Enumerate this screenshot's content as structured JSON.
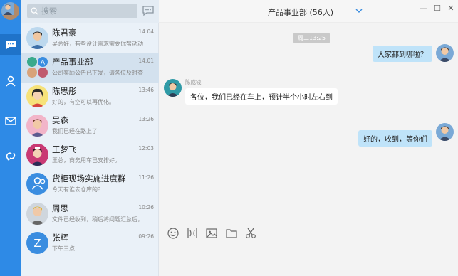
{
  "search": {
    "placeholder": "搜索"
  },
  "conversations": [
    {
      "name": "陈君豪",
      "time": "14:04",
      "preview": "吴总好，有些设计需求需要你帮动动"
    },
    {
      "name": "产品事业部",
      "time": "14:01",
      "preview": "公司奖励公告已下发，请各位及时查",
      "group_letter": "A"
    },
    {
      "name": "陈思彤",
      "time": "13:46",
      "preview": "好的，有空可以再优化。"
    },
    {
      "name": "吴森",
      "time": "13:26",
      "preview": "我们已经在路上了"
    },
    {
      "name": "王梦飞",
      "time": "12:03",
      "preview": "王总，商务用车已安排好。"
    },
    {
      "name": "货柜现场实施进度群",
      "time": "11:26",
      "preview": "今天有谁去仓库的？"
    },
    {
      "name": "周思",
      "time": "10:26",
      "preview": "文件已经收到，稍后将问题汇总后，"
    },
    {
      "name": "张辉",
      "time": "09:26",
      "preview": "下午三点",
      "letter": "Z"
    }
  ],
  "chat": {
    "title": "产品事业部 (56人)",
    "timestamp": "周二13:25",
    "messages": [
      {
        "direction": "out",
        "text": "大家都到哪啦？"
      },
      {
        "direction": "in",
        "sender": "陈成钱",
        "text": "各位，我们已经在车上，预计半个小时左右到"
      },
      {
        "direction": "out",
        "text": "好的，收到，等你们"
      }
    ]
  },
  "window": {
    "minimize": "—",
    "maximize": "☐",
    "close": "✕"
  },
  "colors": {
    "rail": "#2e8ae6",
    "out_bubble": "#bfe3f9",
    "selected_row": "#d3e1ee"
  },
  "icons": {
    "rail": [
      "chat-icon",
      "contacts-icon",
      "mail-icon",
      "link-icon"
    ],
    "toolbar": [
      "emoji-icon",
      "screenshot-icon",
      "image-icon",
      "folder-icon",
      "scissors-icon"
    ]
  }
}
